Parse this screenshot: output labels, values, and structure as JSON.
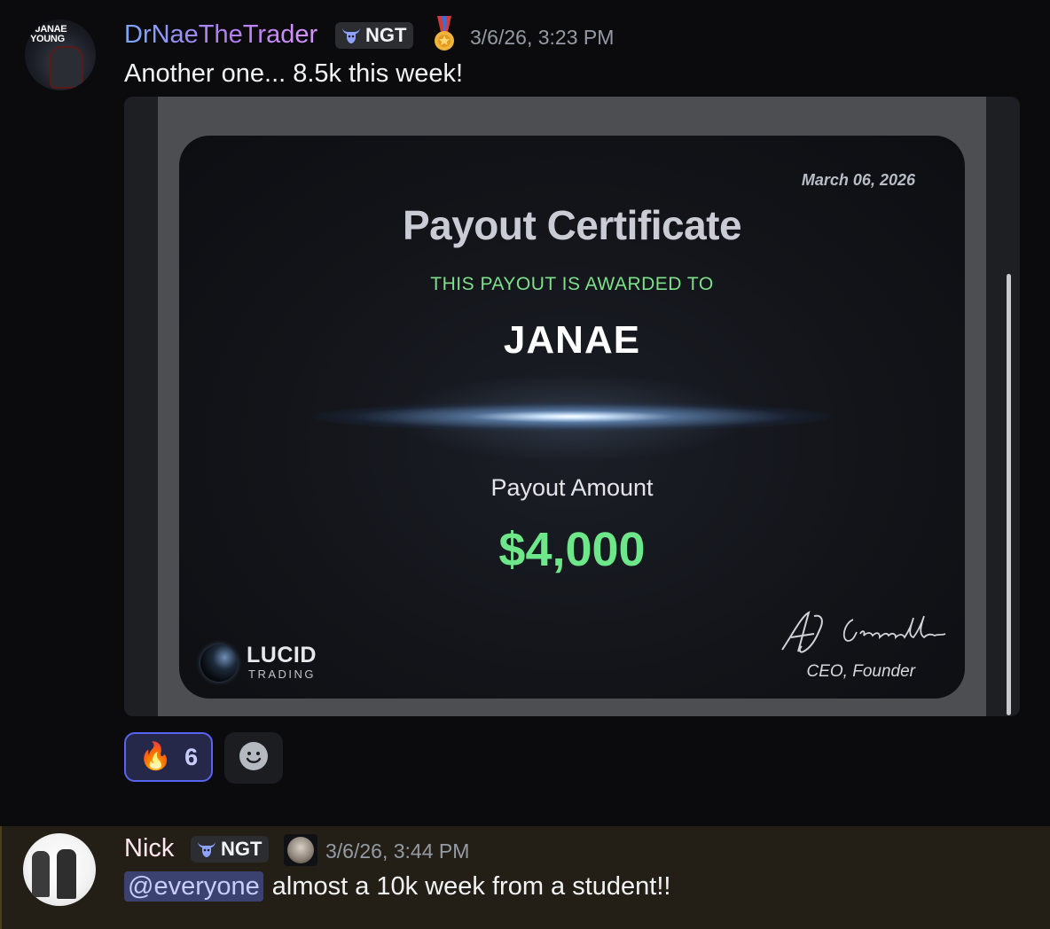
{
  "messages": [
    {
      "username": "DrNaeTheTrader",
      "avatar_text": ". JANAE\nYOUNG",
      "tag": "NGT",
      "tag_icon": "bull-icon",
      "badge_icon": "medal-icon",
      "timestamp": "3/6/26, 3:23 PM",
      "text": "Another one... 8.5k this week!",
      "attachment": {
        "type": "image",
        "certificate": {
          "date": "March 06, 2026",
          "title": "Payout Certificate",
          "awarded_label": "THIS PAYOUT IS AWARDED TO",
          "recipient": "JANAE",
          "amount_label": "Payout Amount",
          "amount": "$4,000",
          "brand_name": "LUCID",
          "brand_sub": "TRADING",
          "signature": "AJ Campanella",
          "signer_title": "CEO, Founder"
        }
      },
      "reactions": [
        {
          "emoji": "🔥",
          "count": "6",
          "selected": true
        }
      ],
      "add_reaction_icon": "smiley-icon"
    },
    {
      "username": "Nick",
      "tag": "NGT",
      "tag_icon": "bull-icon",
      "timestamp": "3/6/26, 3:44 PM",
      "mention": "@everyone",
      "text": "almost a 10k week from a student!!",
      "highlighted": true
    }
  ],
  "colors": {
    "background": "#0b0b0d",
    "mention_highlight_row": "#241f16",
    "reaction_selected_border": "#5865f2",
    "certificate_green": "#6ee68a"
  }
}
